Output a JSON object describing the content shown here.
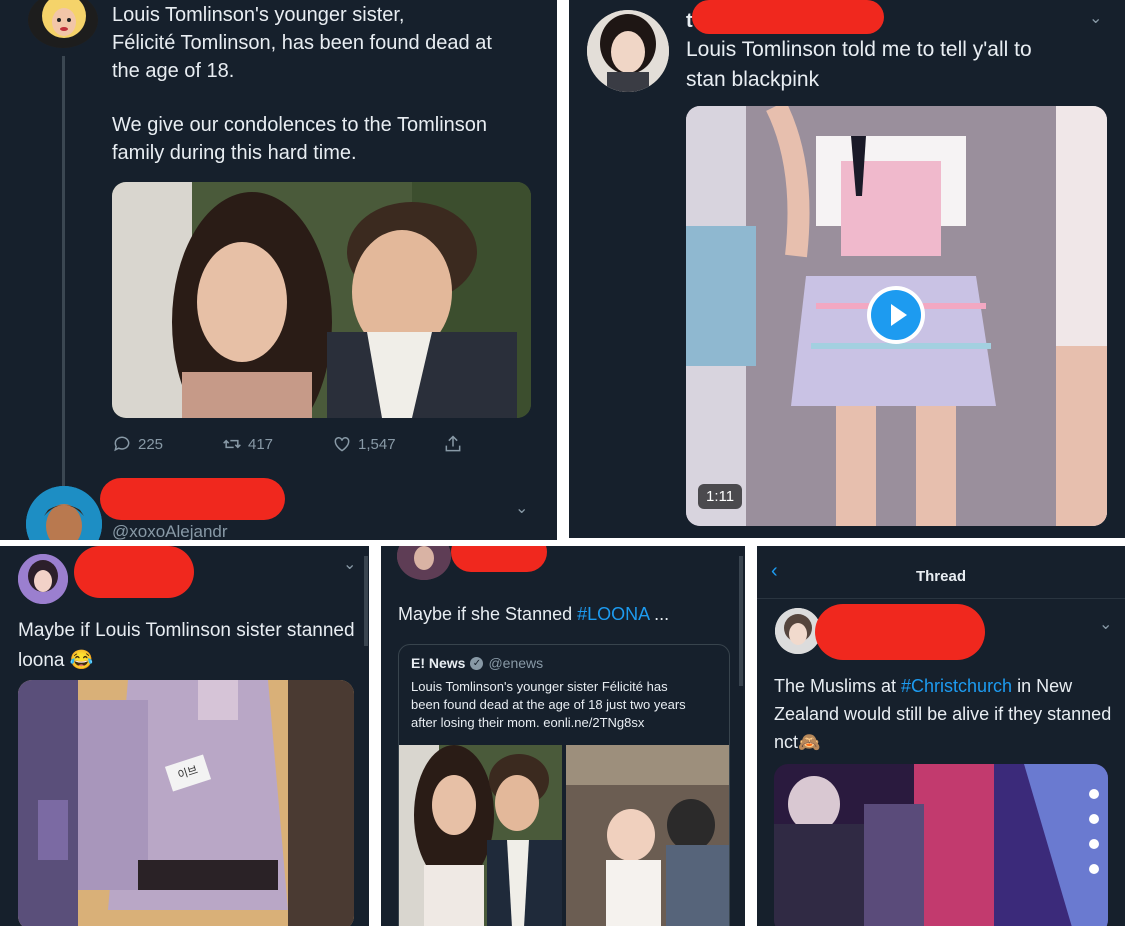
{
  "panel1": {
    "tweet_line1": "Louis Tomlinson's younger sister,",
    "tweet_line2": "Félicité Tomlinson, has been found dead at",
    "tweet_line3": "the age of 18.",
    "tweet_line4": "We give our condolences to the Tomlinson",
    "tweet_line5": "family during this hard time.",
    "replies": "225",
    "retweets": "417",
    "likes": "1,547",
    "next_handle": "@xoxoAlejandr"
  },
  "panel2": {
    "name_initial": "t",
    "tweet_line1": "Louis Tomlinson told me to tell y'all to",
    "tweet_line2": "stan blackpink",
    "video_duration": "1:11"
  },
  "panel3": {
    "tweet_line1": "Maybe if Louis Tomlinson sister stanned",
    "tweet_line2": "loona 😂",
    "badge_text": "이브"
  },
  "panel4": {
    "tweet_prefix": "Maybe if she Stanned ",
    "hashtag": "#LOONA",
    "tweet_suffix": " ...",
    "quote_name": "E! News",
    "quote_handle": "@enews",
    "quote_line1": "Louis Tomlinson's younger sister Félicité has",
    "quote_line2": "been found dead at the age of 18 just two years",
    "quote_line3": "after losing their mom. eonli.ne/2TNg8sx"
  },
  "panel5": {
    "header_title": "Thread",
    "tweet_prefix": "The Muslims at ",
    "hashtag": "#Christchurch",
    "tweet_mid": " in New",
    "tweet_line2": "Zealand would still be alive if they stanned",
    "tweet_line3": "nct🙈"
  },
  "colors": {
    "background": "#16202c",
    "accent": "#1d9bf0",
    "redaction": "#f0281e"
  }
}
